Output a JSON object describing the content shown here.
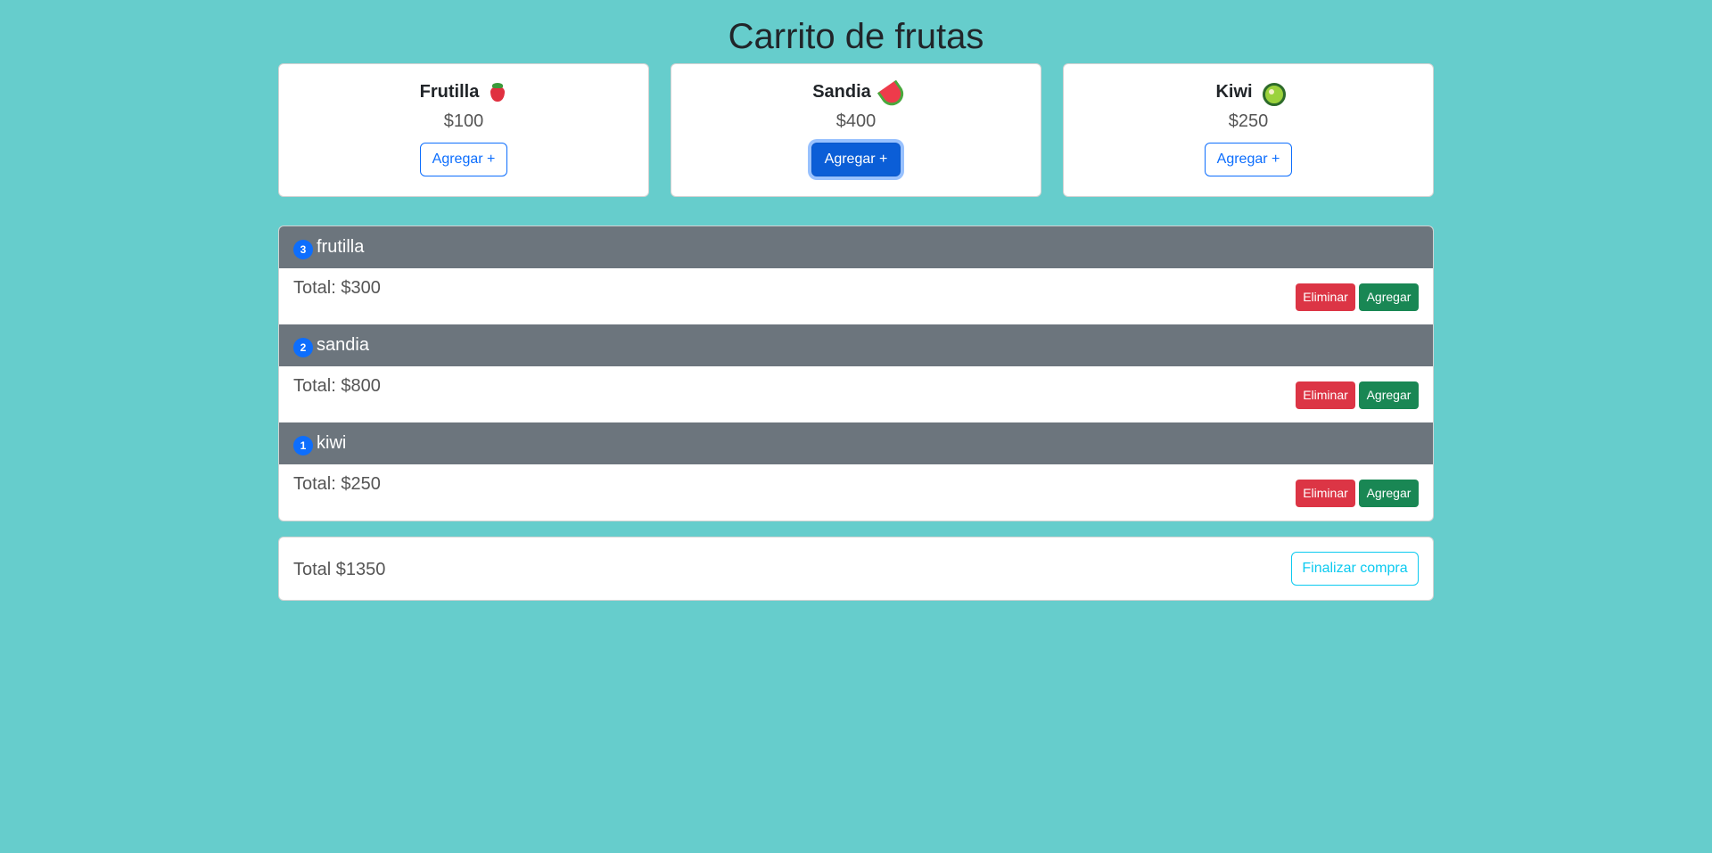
{
  "page": {
    "title": "Carrito de frutas"
  },
  "products": [
    {
      "name": "Frutilla",
      "price": "$100",
      "button": "Agregar +",
      "icon": "strawberry-icon"
    },
    {
      "name": "Sandia",
      "price": "$400",
      "button": "Agregar +",
      "icon": "watermelon-icon"
    },
    {
      "name": "Kiwi",
      "price": "$250",
      "button": "Agregar +",
      "icon": "kiwi-icon"
    }
  ],
  "cart": {
    "items": [
      {
        "qty": "3",
        "name": "frutilla",
        "total": "Total: $300",
        "remove": "Eliminar",
        "add": "Agregar"
      },
      {
        "qty": "2",
        "name": "sandia",
        "total": "Total: $800",
        "remove": "Eliminar",
        "add": "Agregar"
      },
      {
        "qty": "1",
        "name": "kiwi",
        "total": "Total: $250",
        "remove": "Eliminar",
        "add": "Agregar"
      }
    ]
  },
  "summary": {
    "total": "Total $1350",
    "checkout": "Finalizar compra"
  },
  "colors": {
    "background": "#66cdcc",
    "primary": "#0d6efd",
    "header": "#6c757d",
    "danger": "#dc3545",
    "success": "#198754",
    "info": "#0dcaf0"
  }
}
